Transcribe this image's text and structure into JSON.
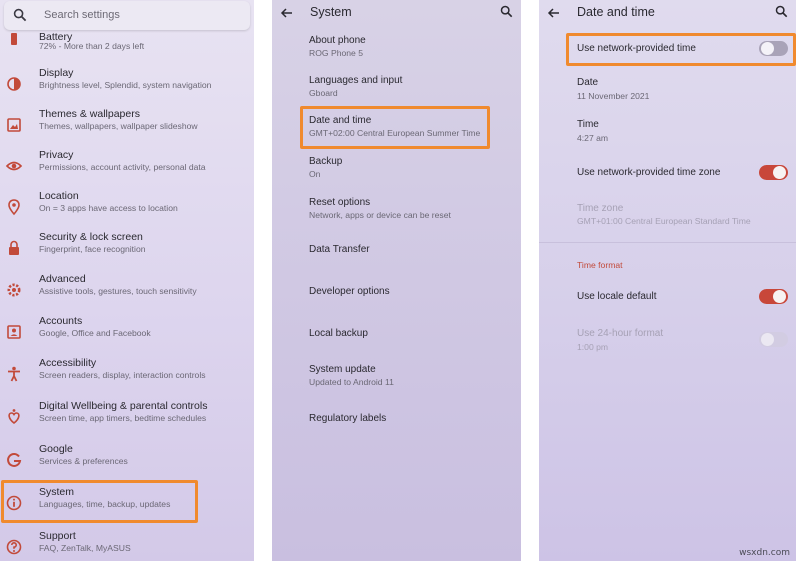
{
  "colors": {
    "accent": "#f08a2e",
    "toggle_on": "#c8473a",
    "section": "#c24a3a"
  },
  "settings": {
    "search_placeholder": "Search settings",
    "items": [
      {
        "title": "Battery",
        "subtitle": "72% - More than 2 days left",
        "icon": "battery-icon"
      },
      {
        "title": "Display",
        "subtitle": "Brightness level, Splendid, system navigation",
        "icon": "brightness-icon"
      },
      {
        "title": "Themes & wallpapers",
        "subtitle": "Themes, wallpapers, wallpaper slideshow",
        "icon": "wallpaper-icon"
      },
      {
        "title": "Privacy",
        "subtitle": "Permissions, account activity, personal data",
        "icon": "eye-icon"
      },
      {
        "title": "Location",
        "subtitle": "On = 3 apps have access to location",
        "icon": "location-pin-icon"
      },
      {
        "title": "Security & lock screen",
        "subtitle": "Fingerprint, face recognition",
        "icon": "lock-icon"
      },
      {
        "title": "Advanced",
        "subtitle": "Assistive tools, gestures, touch sensitivity",
        "icon": "gear-icon"
      },
      {
        "title": "Accounts",
        "subtitle": "Google, Office and Facebook",
        "icon": "account-icon"
      },
      {
        "title": "Accessibility",
        "subtitle": "Screen readers, display, interaction controls",
        "icon": "accessibility-icon"
      },
      {
        "title": "Digital Wellbeing & parental controls",
        "subtitle": "Screen time, app timers, bedtime schedules",
        "icon": "wellbeing-icon"
      },
      {
        "title": "Google",
        "subtitle": "Services & preferences",
        "icon": "google-icon"
      },
      {
        "title": "System",
        "subtitle": "Languages, time, backup, updates",
        "icon": "info-icon"
      },
      {
        "title": "Support",
        "subtitle": "FAQ, ZenTalk, MyASUS",
        "icon": "help-icon"
      }
    ]
  },
  "system": {
    "title": "System",
    "items": [
      {
        "title": "About phone",
        "subtitle": "ROG Phone 5"
      },
      {
        "title": "Languages and input",
        "subtitle": "Gboard"
      },
      {
        "title": "Date and time",
        "subtitle": "GMT+02:00 Central European Summer Time"
      },
      {
        "title": "Backup",
        "subtitle": "On"
      },
      {
        "title": "Reset options",
        "subtitle": "Network, apps or device can be reset"
      },
      {
        "title": "Data Transfer",
        "subtitle": ""
      },
      {
        "title": "Developer options",
        "subtitle": ""
      },
      {
        "title": "Local backup",
        "subtitle": ""
      },
      {
        "title": "System update",
        "subtitle": "Updated to Android 11"
      },
      {
        "title": "Regulatory labels",
        "subtitle": ""
      }
    ]
  },
  "datetime": {
    "title": "Date and time",
    "network_time": {
      "label": "Use network-provided time",
      "enabled": false
    },
    "date": {
      "label": "Date",
      "value": "11 November 2021"
    },
    "time": {
      "label": "Time",
      "value": "4:27 am"
    },
    "network_zone": {
      "label": "Use network-provided time zone",
      "enabled": true
    },
    "time_zone": {
      "label": "Time zone",
      "value": "GMT+01:00 Central European Standard Time"
    },
    "section_time_format": "Time format",
    "locale_default": {
      "label": "Use locale default",
      "enabled": true
    },
    "hour24": {
      "label": "Use 24-hour format",
      "value": "1:00 pm",
      "enabled": false
    }
  },
  "watermark": "wsxdn.com"
}
